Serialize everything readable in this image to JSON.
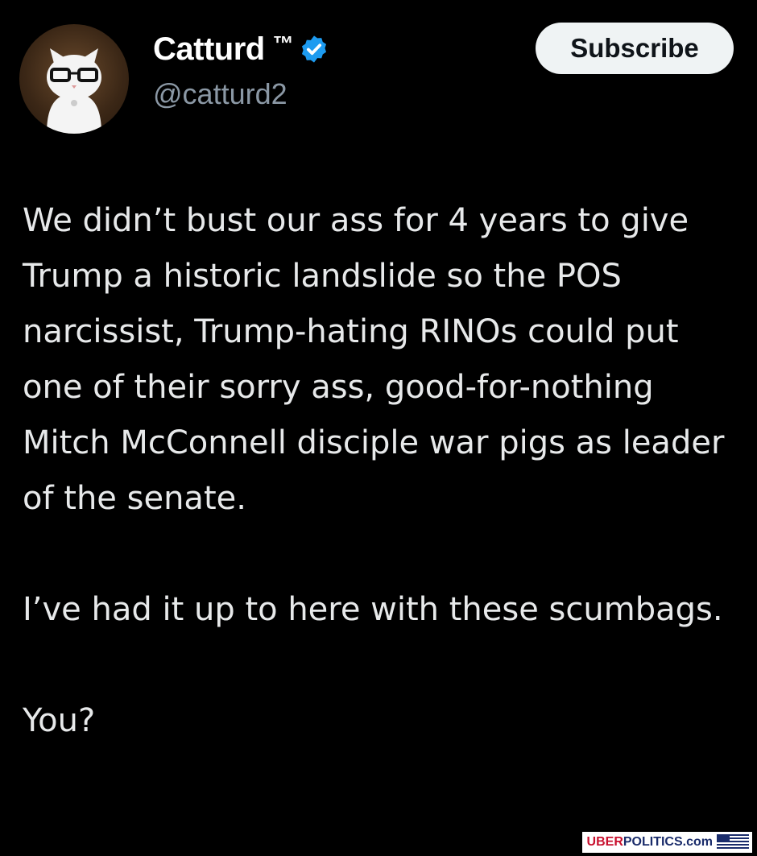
{
  "author": {
    "display_name": "Catturd",
    "trademark": "™",
    "handle": "@catturd2",
    "verified": true,
    "verified_color": "#1d9bf0"
  },
  "actions": {
    "subscribe_label": "Subscribe"
  },
  "tweet": {
    "paragraphs": [
      "We didn’t bust our ass for 4 years to give Trump a historic landslide so the POS narcissist, Trump-hating RINOs could put one of their sorry ass, good-for-nothing Mitch McConnell disciple war pigs as leader of the senate.",
      "I’ve had it up to here with these scumbags.",
      "You?"
    ]
  },
  "watermark": {
    "prefix": "UBER",
    "main": "POLITICS.com",
    "prefix_color": "#c8102e",
    "main_color": "#1a2c6b",
    "icon": "us-flag-icon"
  },
  "colors": {
    "background": "#000000",
    "text_primary": "#e7e9ea",
    "text_secondary": "#8b98a5",
    "button_bg": "#eff3f4"
  }
}
